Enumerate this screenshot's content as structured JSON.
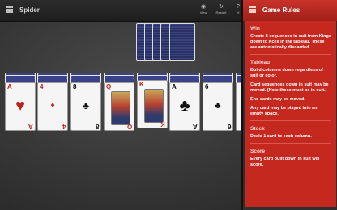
{
  "app": {
    "title": "Spider"
  },
  "toolbar": {
    "items": [
      {
        "label": "View",
        "icon": "eye-icon"
      },
      {
        "label": "Restart",
        "icon": "restart-icon"
      },
      {
        "label": "H",
        "icon": "hint-icon"
      }
    ]
  },
  "tableau": {
    "columns": [
      {
        "rank": "A",
        "suit": "♥",
        "color": "red"
      },
      {
        "rank": "4",
        "suit": "♦",
        "color": "red"
      },
      {
        "rank": "8",
        "suit": "♣",
        "color": "blk"
      },
      {
        "rank": "Q",
        "suit": "♦",
        "color": "red"
      },
      {
        "rank": "K",
        "suit": "♥",
        "color": "red"
      },
      {
        "rank": "A",
        "suit": "♣",
        "color": "blk"
      },
      {
        "rank": "6",
        "suit": "♣",
        "color": "blk"
      }
    ]
  },
  "panel": {
    "title": "Game Rules",
    "sections": [
      {
        "heading": "Win",
        "paragraphs": [
          "Create 8 sequences in suit from Kings down to Aces in the tableau. These are automatically discarded."
        ]
      },
      {
        "heading": "Tableau",
        "paragraphs": [
          "Build columns down regardless of suit or color.",
          "Card sequences down in suit may be moved. (Note these must be in suit.)",
          "End cards may be moved.",
          "Any card may be played into an empty space."
        ]
      },
      {
        "heading": "Stock",
        "paragraphs": [
          "Deals 1 card to each column."
        ]
      },
      {
        "heading": "Score",
        "paragraphs": [
          "Every card built down in suit will score."
        ]
      }
    ]
  }
}
